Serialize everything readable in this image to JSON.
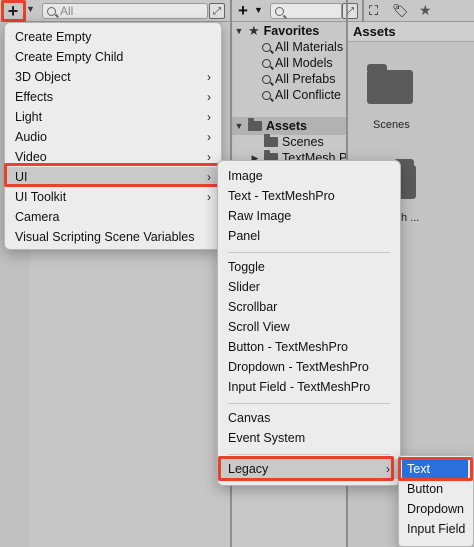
{
  "hierarchy": {
    "search_placeholder": "All",
    "add_button_glyph": "+",
    "dropdown_glyph": "▼"
  },
  "project": {
    "favorites_label": "Favorites",
    "favorites": [
      "All Materials",
      "All Models",
      "All Prefabs",
      "All Conflicte"
    ],
    "assets_label": "Assets",
    "asset_folders": [
      "Scenes",
      "TextMesh P"
    ],
    "assets_panel_title": "Assets",
    "asset_items": [
      "Scenes",
      "h ..."
    ]
  },
  "create_menu": {
    "items": [
      {
        "label": "Create Empty",
        "submenu": false
      },
      {
        "label": "Create Empty Child",
        "submenu": false
      },
      {
        "label": "3D Object",
        "submenu": true
      },
      {
        "label": "Effects",
        "submenu": true
      },
      {
        "label": "Light",
        "submenu": true
      },
      {
        "label": "Audio",
        "submenu": true
      },
      {
        "label": "Video",
        "submenu": true
      },
      {
        "label": "UI",
        "submenu": true
      },
      {
        "label": "UI Toolkit",
        "submenu": true
      },
      {
        "label": "Camera",
        "submenu": false
      },
      {
        "label": "Visual Scripting Scene Variables",
        "submenu": false
      }
    ],
    "arrow_glyph": "›"
  },
  "ui_menu": {
    "group1": [
      "Image",
      "Text - TextMeshPro",
      "Raw Image",
      "Panel"
    ],
    "group2": [
      "Toggle",
      "Slider",
      "Scrollbar",
      "Scroll View",
      "Button - TextMeshPro",
      "Dropdown - TextMeshPro",
      "Input Field - TextMeshPro"
    ],
    "group3": [
      "Canvas",
      "Event System"
    ],
    "group4": [
      "Legacy"
    ]
  },
  "legacy_menu": {
    "items": [
      "Text",
      "Button",
      "Dropdown",
      "Input Field"
    ]
  },
  "colors": {
    "highlight": "#e8412c",
    "selection_blue": "#2a6fdb"
  }
}
